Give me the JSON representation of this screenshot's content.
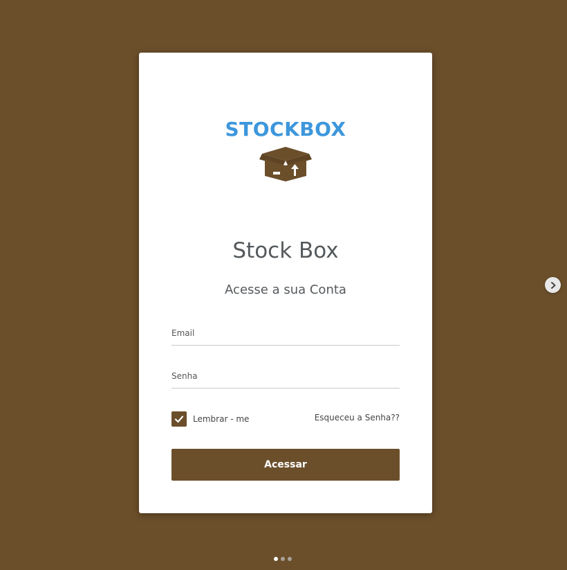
{
  "logo": {
    "text": "STOCKBOX"
  },
  "login": {
    "title": "Stock Box",
    "subtitle": "Acesse a sua Conta",
    "email_placeholder": "Email",
    "password_placeholder": "Senha",
    "remember_label": "Lembrar - me",
    "remember_checked": true,
    "forgot_label": "Esqueceu a Senha??",
    "submit_label": "Acessar"
  },
  "carousel": {
    "slide_count": 3,
    "active_slide": 1,
    "next_icon": "chevron-right-icon"
  },
  "colors": {
    "background": "#6b4f2b",
    "logo_blue": "#3d97dc",
    "card": "#ffffff",
    "button": "#6b4f2b"
  }
}
